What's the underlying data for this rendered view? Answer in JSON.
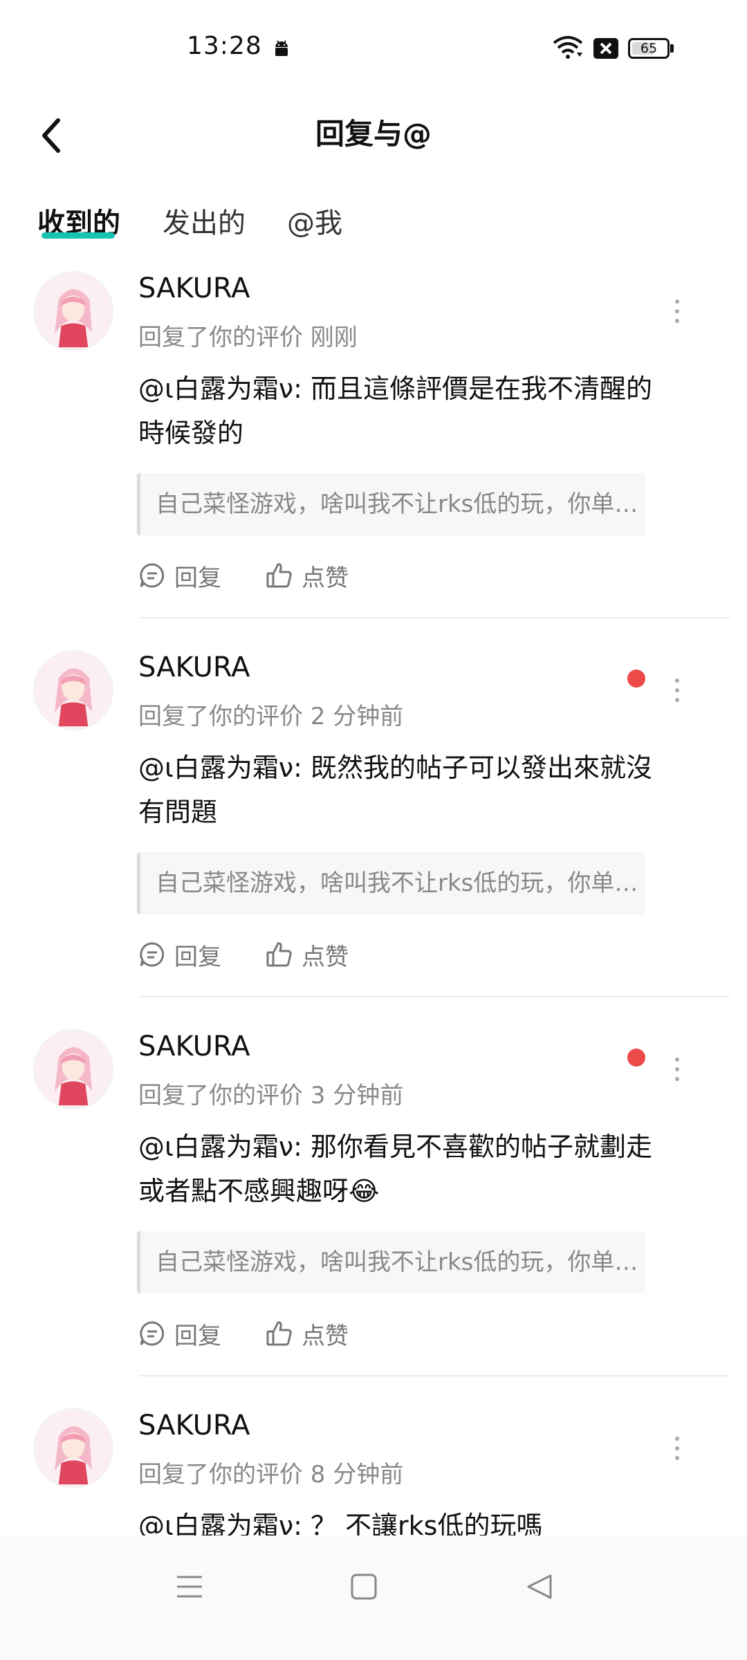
{
  "status_bar": {
    "time": "13:28",
    "battery_level": "65",
    "battery_fraction": 0.65,
    "icons": [
      "android-icon",
      "wifi-icon",
      "x-icon",
      "battery-icon"
    ]
  },
  "header": {
    "title": "回复与@",
    "back_icon": "chevron-left-icon"
  },
  "tabs": [
    {
      "label": "收到的",
      "active": true
    },
    {
      "label": "发出的",
      "active": false
    },
    {
      "label": "@我",
      "active": false
    }
  ],
  "colors": {
    "accent": "#19c3b3",
    "unread": "#ec4a48",
    "muted_text": "#888888"
  },
  "items": [
    {
      "username": "SAKURA",
      "meta": "回复了你的评价 刚刚",
      "unread": false,
      "content_line1": "@ι白露为霜ν: 而且這條評價是在我不清醒的",
      "content_line2": "時候發的",
      "quote": "自己菜怪游戏，啥叫我不让rks低的玩，你单…",
      "reply_label": "回复",
      "like_label": "点赞"
    },
    {
      "username": "SAKURA",
      "meta": "回复了你的评价 2 分钟前",
      "unread": true,
      "content_line1": "@ι白露为霜ν: 既然我的帖子可以發出來就沒",
      "content_line2": "有問題",
      "quote": "自己菜怪游戏，啥叫我不让rks低的玩，你单…",
      "reply_label": "回复",
      "like_label": "点赞"
    },
    {
      "username": "SAKURA",
      "meta": "回复了你的评价 3 分钟前",
      "unread": true,
      "content_line1": "@ι白露为霜ν: 那你看見不喜歡的帖子就劃走",
      "content_line2": "或者點不感興趣呀😂",
      "quote": "自己菜怪游戏，啥叫我不让rks低的玩，你单…",
      "reply_label": "回复",
      "like_label": "点赞"
    },
    {
      "username": "SAKURA",
      "meta": "回复了你的评价 8 分钟前",
      "unread": false,
      "content_line1": "@ι白露为霜ν: ？ 不讓rks低的玩嗎",
      "content_line2": "",
      "quote": "",
      "reply_label": "",
      "like_label": ""
    }
  ],
  "nav_bar": {
    "icons": [
      "menu-icon",
      "home-square-icon",
      "back-triangle-icon"
    ]
  }
}
